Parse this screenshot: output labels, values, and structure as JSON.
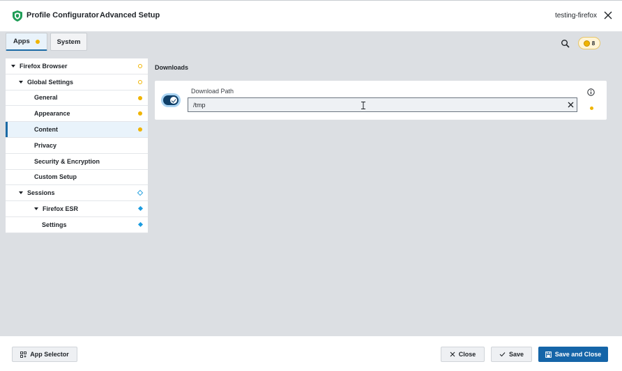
{
  "header": {
    "app_name": "Profile Configurator",
    "subtitle": "Advanced Setup",
    "profile_name": "testing-firefox"
  },
  "tabs": [
    {
      "label": "Apps",
      "active": true,
      "has_changes": true
    },
    {
      "label": "System",
      "active": false,
      "has_changes": false
    }
  ],
  "toolbar": {
    "change_count": "8"
  },
  "tree": [
    {
      "label": "Firefox Browser",
      "level": 0,
      "expandable": true,
      "marker": "ring-yellow"
    },
    {
      "label": "Global Settings",
      "level": 1,
      "expandable": true,
      "marker": "ring-yellow"
    },
    {
      "label": "General",
      "level": 2,
      "expandable": false,
      "marker": "dot-yellow"
    },
    {
      "label": "Appearance",
      "level": 2,
      "expandable": false,
      "marker": "dot-yellow"
    },
    {
      "label": "Content",
      "level": 2,
      "expandable": false,
      "marker": "dot-yellow",
      "selected": true
    },
    {
      "label": "Privacy",
      "level": 2,
      "expandable": false,
      "marker": ""
    },
    {
      "label": "Security & Encryption",
      "level": 2,
      "expandable": false,
      "marker": ""
    },
    {
      "label": "Custom Setup",
      "level": 2,
      "expandable": false,
      "marker": ""
    },
    {
      "label": "Sessions",
      "level": 1,
      "expandable": true,
      "marker": "ring-blue"
    },
    {
      "label": "Firefox ESR",
      "level": 2,
      "expandable": true,
      "marker": "diamond-blue"
    },
    {
      "label": "Settings",
      "level": 3,
      "expandable": false,
      "marker": "diamond-blue"
    }
  ],
  "main": {
    "section_title": "Downloads",
    "field": {
      "label": "Download Path",
      "value": "/tmp",
      "enabled": true,
      "modified": true
    }
  },
  "footer": {
    "app_selector_label": "App Selector",
    "close_label": "Close",
    "save_label": "Save",
    "save_close_label": "Save and Close"
  },
  "colors": {
    "accent": "#1565a8",
    "change_marker": "#f0b400",
    "session_marker": "#1b9ce0",
    "logo": "#1f9d57"
  }
}
